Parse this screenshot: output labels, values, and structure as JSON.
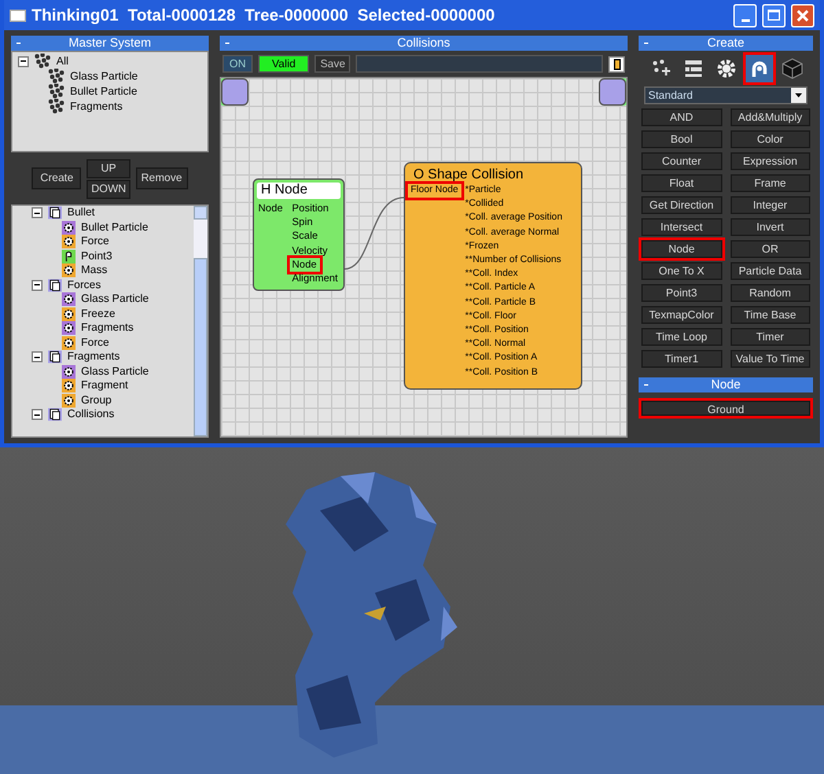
{
  "window": {
    "title": "Thinking01  Total-0000128  Tree-0000000  Selected-0000000"
  },
  "master_system": {
    "title": "Master System",
    "tree": [
      {
        "label": "All",
        "expanded": true,
        "children": [
          {
            "label": "Glass Particle"
          },
          {
            "label": "Bullet Particle"
          },
          {
            "label": "Fragments"
          }
        ]
      }
    ],
    "buttons": {
      "create": "Create",
      "up": "UP",
      "down": "DOWN",
      "remove": "Remove"
    },
    "groups": [
      {
        "label": "Bullet",
        "expanded": true,
        "children": [
          {
            "label": "Bullet Particle",
            "kind": "particle"
          },
          {
            "label": "Force",
            "kind": "operator"
          },
          {
            "label": "Point3",
            "kind": "point"
          },
          {
            "label": "Mass",
            "kind": "operator"
          }
        ]
      },
      {
        "label": "Forces",
        "expanded": true,
        "children": [
          {
            "label": "Glass Particle",
            "kind": "particle"
          },
          {
            "label": "Freeze",
            "kind": "operator"
          },
          {
            "label": "Fragments",
            "kind": "particle"
          },
          {
            "label": "Force",
            "kind": "operator"
          }
        ]
      },
      {
        "label": "Fragments",
        "expanded": true,
        "children": [
          {
            "label": "Glass Particle",
            "kind": "particle"
          },
          {
            "label": "Fragment",
            "kind": "operator"
          },
          {
            "label": "Group",
            "kind": "operator"
          }
        ]
      },
      {
        "label": "Collisions",
        "expanded": true
      }
    ]
  },
  "editor": {
    "title": "Collisions",
    "on": "ON",
    "valid": "Valid",
    "save": "Save",
    "h_node": {
      "title": "H Node",
      "input": "Node",
      "outputs": [
        {
          "label": "Position",
          "highlighted": false
        },
        {
          "label": "Spin",
          "highlighted": false
        },
        {
          "label": "Scale",
          "highlighted": false
        },
        {
          "label": "Velocity",
          "highlighted": false
        },
        {
          "label": "Node",
          "highlighted": true
        },
        {
          "label": "Alignment",
          "highlighted": false
        }
      ]
    },
    "shape_collision": {
      "title": "O Shape Collision",
      "input": {
        "label": "Floor Node",
        "highlighted": true
      },
      "outputs": [
        "*Particle",
        "*Collided",
        "*Coll. average Position",
        "*Coll. average Normal",
        "*Frozen",
        "**Number of Collisions",
        "**Coll. Index",
        "**Coll. Particle A",
        "**Coll. Particle B",
        "**Coll. Floor",
        "**Coll. Position",
        "**Coll. Normal",
        "**Coll. Position A",
        "**Coll. Position B"
      ]
    }
  },
  "create": {
    "title": "Create",
    "tool_icons": [
      {
        "kind": "particles",
        "selected": false
      },
      {
        "kind": "list",
        "selected": false
      },
      {
        "kind": "gear",
        "selected": false
      },
      {
        "kind": "hook",
        "selected": true
      },
      {
        "kind": "cube",
        "selected": false
      }
    ],
    "dropdown": "Standard",
    "buttons": [
      {
        "label": "AND",
        "selected": false
      },
      {
        "label": "Add&Multiply",
        "selected": false
      },
      {
        "label": "Bool",
        "selected": false
      },
      {
        "label": "Color",
        "selected": false
      },
      {
        "label": "Counter",
        "selected": false
      },
      {
        "label": "Expression",
        "selected": false
      },
      {
        "label": "Float",
        "selected": false
      },
      {
        "label": "Frame",
        "selected": false
      },
      {
        "label": "Get Direction",
        "selected": false
      },
      {
        "label": "Integer",
        "selected": false
      },
      {
        "label": "Intersect",
        "selected": false
      },
      {
        "label": "Invert",
        "selected": false
      },
      {
        "label": "Node",
        "selected": true
      },
      {
        "label": "OR",
        "selected": false
      },
      {
        "label": "One To X",
        "selected": false
      },
      {
        "label": "Particle Data",
        "selected": false
      },
      {
        "label": "Point3",
        "selected": false
      },
      {
        "label": "Random",
        "selected": false
      },
      {
        "label": "TexmapColor",
        "selected": false
      },
      {
        "label": "Time Base",
        "selected": false
      },
      {
        "label": "Time Loop",
        "selected": false
      },
      {
        "label": "Timer",
        "selected": false
      },
      {
        "label": "Timer1",
        "selected": false
      },
      {
        "label": "Value To Time",
        "selected": false
      }
    ]
  },
  "node_panel": {
    "title": "Node",
    "items": [
      {
        "label": "Ground",
        "selected": true
      }
    ]
  }
}
